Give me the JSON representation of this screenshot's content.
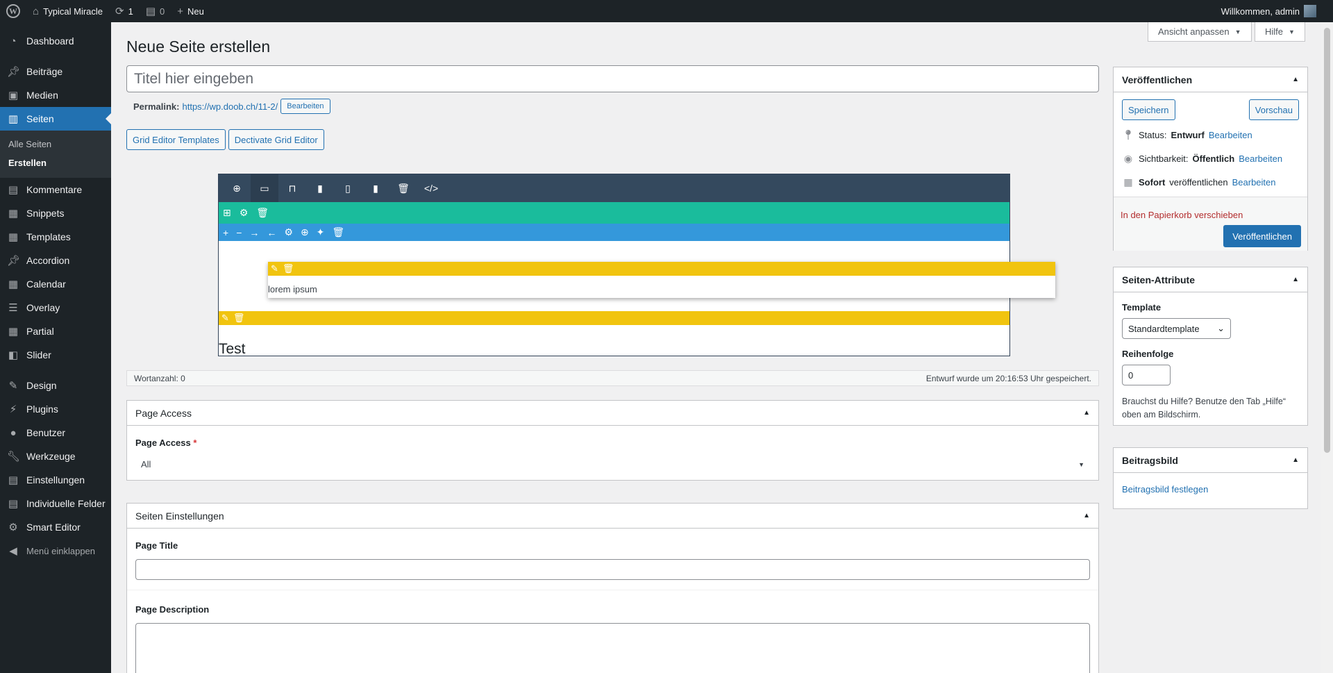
{
  "adminbar": {
    "site_name": "Typical Miracle",
    "updates_count": "1",
    "comments_count": "0",
    "new_label": "Neu",
    "greeting": "Willkommen, admin"
  },
  "sidebar": {
    "items": [
      {
        "label": "Dashboard",
        "icon": "dashboard-icon"
      },
      {
        "label": "Beiträge",
        "icon": "pin-icon"
      },
      {
        "label": "Medien",
        "icon": "media-icon"
      },
      {
        "label": "Seiten",
        "icon": "page-icon"
      },
      {
        "label": "Kommentare",
        "icon": "comment-icon"
      },
      {
        "label": "Snippets",
        "icon": "snippet-icon"
      },
      {
        "label": "Templates",
        "icon": "template-icon"
      },
      {
        "label": "Accordion",
        "icon": "pin-icon"
      },
      {
        "label": "Calendar",
        "icon": "calendar-icon"
      },
      {
        "label": "Overlay",
        "icon": "overlay-icon"
      },
      {
        "label": "Partial",
        "icon": "partial-icon"
      },
      {
        "label": "Slider",
        "icon": "slider-icon"
      },
      {
        "label": "Design",
        "icon": "brush-icon"
      },
      {
        "label": "Plugins",
        "icon": "plugin-icon"
      },
      {
        "label": "Benutzer",
        "icon": "user-icon"
      },
      {
        "label": "Werkzeuge",
        "icon": "wrench-icon"
      },
      {
        "label": "Einstellungen",
        "icon": "settings-icon"
      },
      {
        "label": "Individuelle Felder",
        "icon": "fields-icon"
      },
      {
        "label": "Smart Editor",
        "icon": "gear-icon"
      }
    ],
    "submenu": [
      "Alle Seiten",
      "Erstellen"
    ],
    "collapse_label": "Menü einklappen"
  },
  "top_buttons": {
    "screen_options": "Ansicht anpassen",
    "help": "Hilfe"
  },
  "page": {
    "title": "Neue Seite erstellen",
    "title_placeholder": "Titel hier eingeben",
    "permalink_label": "Permalink:",
    "permalink_url": "https://wp.doob.ch/11-2/",
    "permalink_edit": "Bearbeiten",
    "grid_templates_btn": "Grid Editor Templates",
    "deactivate_btn": "Dectivate Grid Editor"
  },
  "grid_editor": {
    "element1_text": "lorem ipsum",
    "element2_text": "Test"
  },
  "statusbar": {
    "word_count": "Wortanzahl: 0",
    "draft_saved": "Entwurf wurde um 20:16:53 Uhr gespeichert."
  },
  "page_access": {
    "heading": "Page Access",
    "field_label": "Page Access",
    "required_mark": "*",
    "value": "All"
  },
  "seo": {
    "heading": "Seiten Einstellungen",
    "title_label": "Page Title",
    "description_label": "Page Description"
  },
  "publish": {
    "heading": "Veröffentlichen",
    "save": "Speichern",
    "preview": "Vorschau",
    "status_label": "Status:",
    "status_value": "Entwurf",
    "visibility_label": "Sichtbarkeit:",
    "visibility_value": "Öffentlich",
    "schedule_bold": "Sofort",
    "schedule_rest": "veröffentlichen",
    "edit_link": "Bearbeiten",
    "trash": "In den Papierkorb verschieben",
    "publish_btn": "Veröffentlichen"
  },
  "attributes": {
    "heading": "Seiten-Attribute",
    "template_label": "Template",
    "template_value": "Standardtemplate",
    "order_label": "Reihenfolge",
    "order_value": "0",
    "help_text_1": "Brauchst du Hilfe? Benutze den Tab „Hilfe“",
    "help_text_2": "oben am Bildschirm."
  },
  "featured": {
    "heading": "Beitragsbild",
    "set_link": "Beitragsbild festlegen"
  },
  "colors": {
    "accent": "#2271b1",
    "toolbar": "#34495e",
    "row": "#1abc9c",
    "column": "#3498db",
    "element": "#f1c40f",
    "trash_link": "#b32d2e"
  }
}
